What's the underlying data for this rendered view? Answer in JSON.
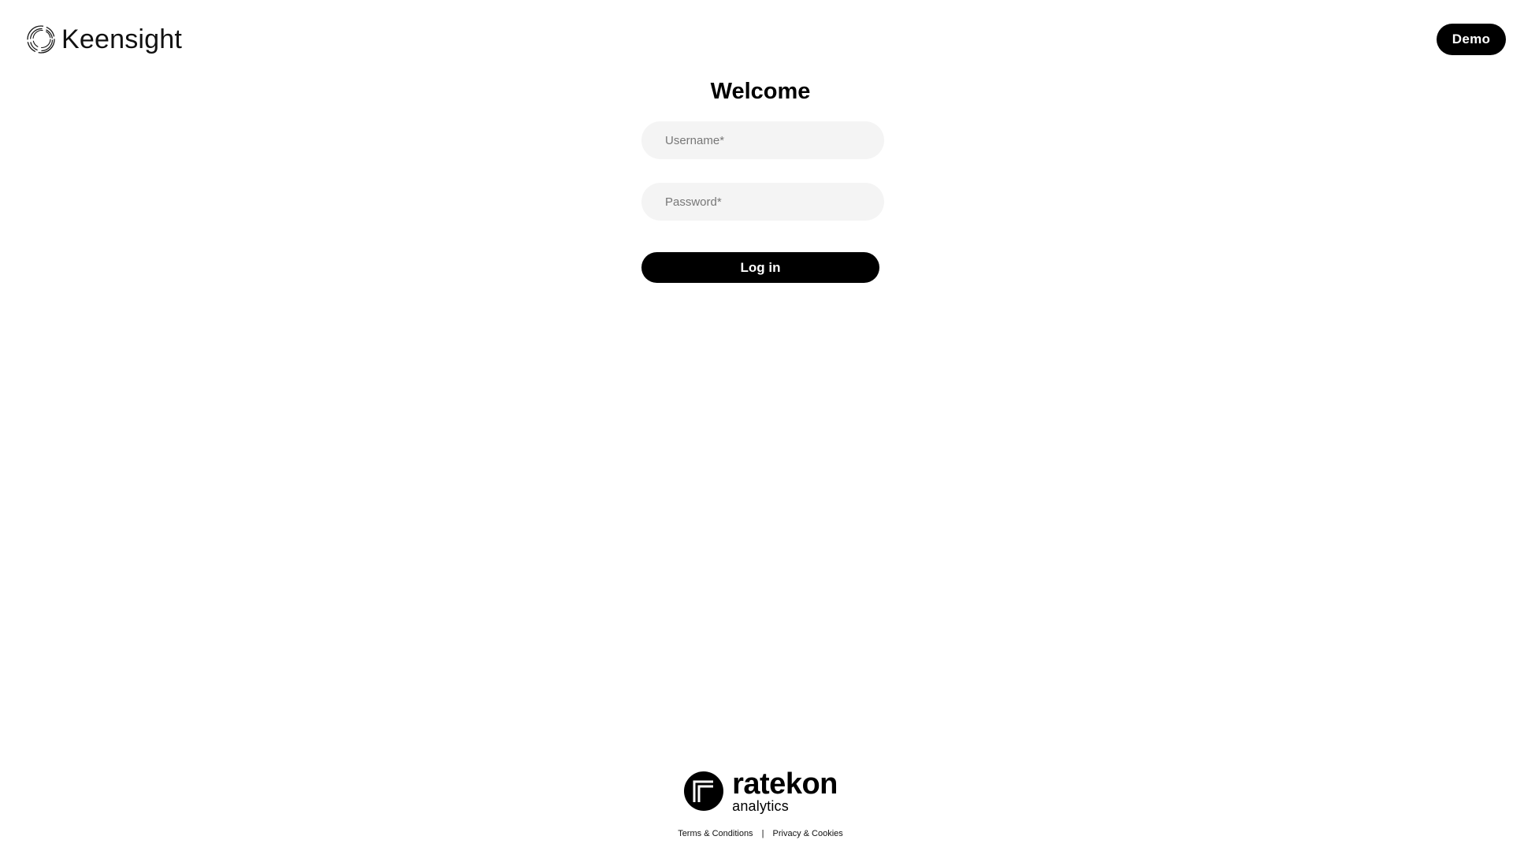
{
  "header": {
    "brand_name": "Keensight",
    "demo_label": "Demo"
  },
  "login": {
    "title": "Welcome",
    "username_placeholder": "Username*",
    "password_placeholder": "Password*",
    "submit_label": "Log in"
  },
  "footer": {
    "logo_name": "ratekon",
    "logo_subtitle": "analytics",
    "terms_label": "Terms & Conditions",
    "separator": "|",
    "privacy_label": "Privacy & Cookies"
  },
  "colors": {
    "primary": "#000000",
    "field_background": "#f4f4f4",
    "background": "#ffffff"
  },
  "icons": {
    "brand_logo": "keensight-swirl-icon",
    "footer_logo": "ratekon-circle-icon"
  }
}
